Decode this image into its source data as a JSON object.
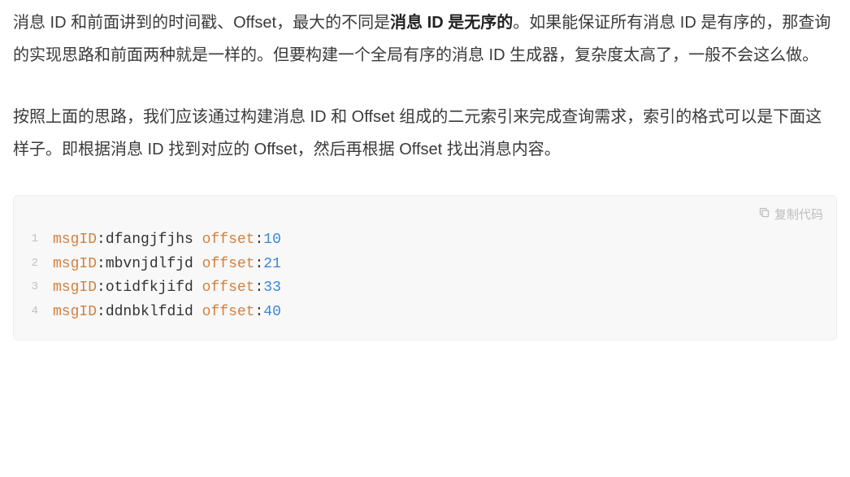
{
  "para1": {
    "t1": "消息 ID 和前面讲到的时间戳、Offset，最大的不同是",
    "bold": "消息 ID 是无序的",
    "t2": "。如果能保证所有消息 ID 是有序的，那查询的实现思路和前面两种就是一样的。但要构建一个全局有序的消息 ID 生成器，复杂度太高了，一般不会这么做。"
  },
  "para2": "按照上面的思路，我们应该通过构建消息 ID 和 Offset 组成的二元索引来完成查询需求，索引的格式可以是下面这样子。即根据消息 ID 找到对应的 Offset，然后再根据 Offset 找出消息内容。",
  "copy_label": "复制代码",
  "code": {
    "lines": [
      {
        "no": "1",
        "id": "dfangjfjhs",
        "off": "10"
      },
      {
        "no": "2",
        "id": "mbvnjdlfjd",
        "off": "21"
      },
      {
        "no": "3",
        "id": "otidfkjifd",
        "off": "33"
      },
      {
        "no": "4",
        "id": "ddnbklfdid",
        "off": "40"
      }
    ],
    "prefix1": "msgID",
    "prefix2": "offset"
  }
}
